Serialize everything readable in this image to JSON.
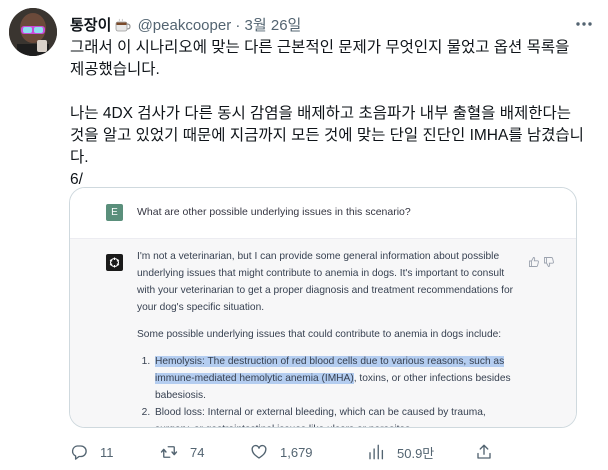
{
  "tweet": {
    "display_name": "통장이",
    "handle": "@peakcooper",
    "separator": "·",
    "date": "3월 26일",
    "text": "그래서 이 시나리오에 맞는 다른 근본적인 문제가 무엇인지 물었고 옵션 목록을 제공했습니다.\n\n나는 4DX 검사가 다른 동시 감염을 배제하고 초음파가 내부 출혈을 배제한다는 것을 알고 있었기 때문에 지금까지 모든 것에 맞는 단일 진단인 IMHA를 남겼습니다.\n6/"
  },
  "chat": {
    "user_badge": "E",
    "question": "What are other possible underlying issues in this scenario?",
    "answer_intro": "I'm not a veterinarian, but I can provide some general information about possible underlying issues that might contribute to anemia in dogs. It's important to consult with your veterinarian to get a proper diagnosis and treatment recommendations for your dog's specific situation.",
    "answer_lead": "Some possible underlying issues that could contribute to anemia in dogs include:",
    "item1_highlighted": "Hemolysis: The destruction of red blood cells due to various reasons, such as immune-mediated hemolytic anemia (IMHA)",
    "item1_rest": ", toxins, or other infections besides babesiosis.",
    "item2": "Blood loss: Internal or external bleeding, which can be caused by trauma, surgery, or gastrointestinal issues like ulcers or parasites."
  },
  "actions": {
    "reply_count": "11",
    "retweet_count": "74",
    "like_count": "1,679",
    "view_count": "50.9만"
  },
  "icons": [
    "avatar",
    "coffee-mug-emoji",
    "more-icon",
    "openai-logo-icon",
    "thumbs-up-icon",
    "thumbs-down-icon",
    "reply-icon",
    "retweet-icon",
    "like-icon",
    "views-icon",
    "share-icon"
  ],
  "colors": {
    "text": "#0f1419",
    "secondary": "#536471",
    "highlight": "#b4cdf0",
    "user_badge": "#5a8f7b",
    "answer_bg": "#f7f7f8"
  }
}
